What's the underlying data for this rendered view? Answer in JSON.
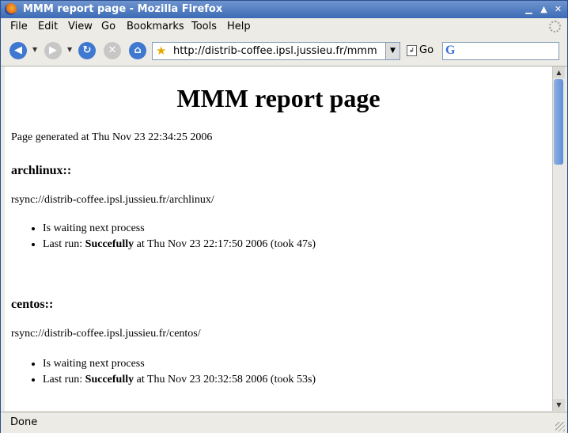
{
  "window": {
    "title": "MMM report page - Mozilla Firefox"
  },
  "menu": {
    "items": [
      {
        "label": "File"
      },
      {
        "label": "Edit"
      },
      {
        "label": "View"
      },
      {
        "label": "Go"
      },
      {
        "label": "Bookmarks"
      },
      {
        "label": "Tools"
      },
      {
        "label": "Help"
      }
    ]
  },
  "nav": {
    "url": "http://distrib-coffee.ipsl.jussieu.fr/mmm",
    "go_label": "Go",
    "search_value": ""
  },
  "page": {
    "heading": "MMM report page",
    "generated": "Page generated at Thu Nov 23 22:34:25 2006",
    "sections": [
      {
        "name": "archlinux::",
        "url": "rsync://distrib-coffee.ipsl.jussieu.fr/archlinux/",
        "status": "Is waiting next process",
        "last_run_prefix": "Last run: ",
        "last_run_result": "Succefully",
        "last_run_suffix": " at Thu Nov 23 22:17:50 2006 (took 47s)"
      },
      {
        "name": "centos::",
        "url": "rsync://distrib-coffee.ipsl.jussieu.fr/centos/",
        "status": "Is waiting next process",
        "last_run_prefix": "Last run: ",
        "last_run_result": "Succefully",
        "last_run_suffix": " at Thu Nov 23 20:32:58 2006 (took 53s)"
      }
    ]
  },
  "status": {
    "text": "Done"
  },
  "colors": {
    "titlebar": "#3c6bb5",
    "scroll_thumb": "#5f8ed8"
  }
}
